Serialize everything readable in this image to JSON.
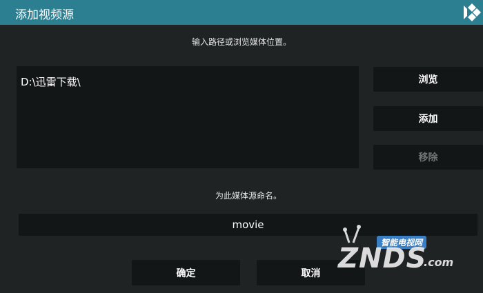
{
  "dialog": {
    "title": "添加视频源",
    "instruction": "输入路径或浏览媒体位置。",
    "paths": [
      "D:\\迅雷下载\\"
    ],
    "name_label": "为此媒体源命名。",
    "name_value": "movie"
  },
  "side_buttons": {
    "browse": "浏览",
    "add": "添加",
    "remove": "移除"
  },
  "bottom_buttons": {
    "ok": "确定",
    "cancel": "取消"
  },
  "watermark": {
    "tag": "智能电视网",
    "logo": "ZNDS",
    "suffix": ".com"
  },
  "colors": {
    "titlebar": "#2c7f91",
    "background": "#1f2324",
    "control": "#131617",
    "disabled_text": "#6f7475"
  },
  "icons": {
    "app_logo": "kodi-logo-icon"
  }
}
